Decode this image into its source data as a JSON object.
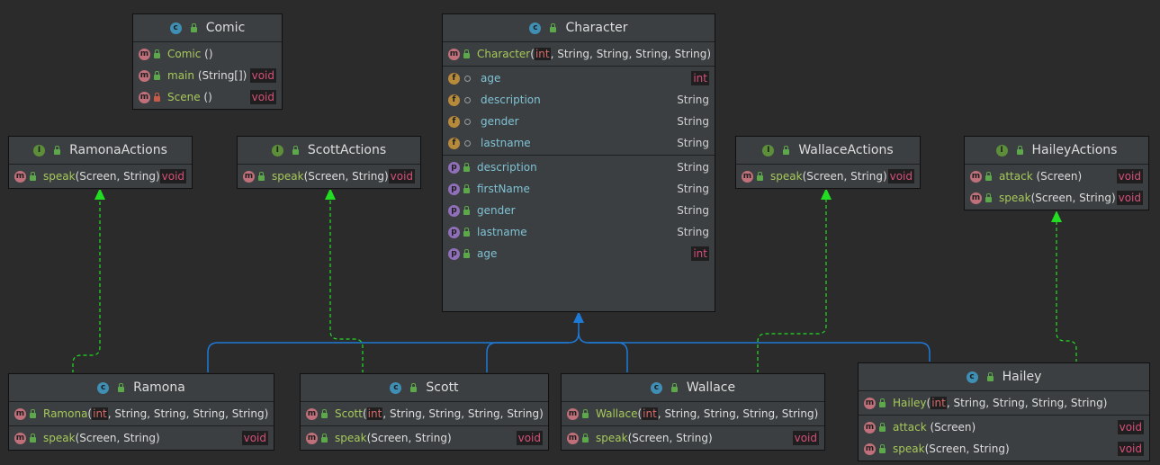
{
  "comic": {
    "title": "Comic",
    "methods": [
      {
        "name": "Comic",
        "args": "()",
        "type": ""
      },
      {
        "name": "main",
        "args": "(String[])",
        "type": "void"
      },
      {
        "name": "Scene",
        "args": "()",
        "type": "void"
      }
    ]
  },
  "character": {
    "title": "Character",
    "constructor": {
      "name": "Character",
      "args": [
        "int",
        "String",
        "String",
        "String",
        "String"
      ]
    },
    "fields": [
      {
        "name": "age",
        "type": "int"
      },
      {
        "name": "description",
        "type": "String"
      },
      {
        "name": "gender",
        "type": "String"
      },
      {
        "name": "lastname",
        "type": "String"
      }
    ],
    "properties": [
      {
        "name": "description",
        "type": "String"
      },
      {
        "name": "firstName",
        "type": "String"
      },
      {
        "name": "gender",
        "type": "String"
      },
      {
        "name": "lastname",
        "type": "String"
      },
      {
        "name": "age",
        "type": "int"
      }
    ]
  },
  "interfaces": {
    "ramona": {
      "title": "RamonaActions",
      "methods": [
        {
          "name": "speak",
          "args": "(Screen, String)",
          "type": "void"
        }
      ]
    },
    "scott": {
      "title": "ScottActions",
      "methods": [
        {
          "name": "speak",
          "args": "(Screen, String)",
          "type": "void"
        }
      ]
    },
    "wallace": {
      "title": "WallaceActions",
      "methods": [
        {
          "name": "speak",
          "args": "(Screen, String)",
          "type": "void"
        }
      ]
    },
    "hailey": {
      "title": "HaileyActions",
      "methods": [
        {
          "name": "attack",
          "args": "(Screen)",
          "type": "void"
        },
        {
          "name": "speak",
          "args": "(Screen, String)",
          "type": "void"
        }
      ]
    }
  },
  "classes": {
    "ramona": {
      "title": "Ramona",
      "ctor": "Ramona",
      "methods": [
        {
          "name": "speak",
          "args": "(Screen, String)",
          "type": "void"
        }
      ]
    },
    "scott": {
      "title": "Scott",
      "ctor": "Scott",
      "methods": [
        {
          "name": "speak",
          "args": "(Screen, String)",
          "type": "void"
        }
      ]
    },
    "wallace": {
      "title": "Wallace",
      "ctor": "Wallace",
      "methods": [
        {
          "name": "speak",
          "args": "(Screen, String)",
          "type": "void"
        }
      ]
    },
    "hailey": {
      "title": "Hailey",
      "ctor": "Hailey",
      "methods": [
        {
          "name": "attack",
          "args": "(Screen)",
          "type": "void"
        },
        {
          "name": "speak",
          "args": "(Screen, String)",
          "type": "void"
        }
      ]
    }
  },
  "ctor_args": [
    "int",
    "String",
    "String",
    "String",
    "String"
  ],
  "colors": {
    "background": "#2b2b2b",
    "box": "#3c3f41",
    "inherit_arrow": "#1e7ad6",
    "realize_arrow": "#22dd22",
    "method_name": "#a6c95a",
    "field_name": "#7ec2d4",
    "primitive_type": "#d6507a"
  },
  "icons": {
    "class": "class-c-icon",
    "interface": "interface-i-icon",
    "method": "method-m-icon",
    "field": "field-f-icon",
    "property": "property-p-icon",
    "public": "public-lock-icon",
    "private": "private-lock-icon"
  }
}
